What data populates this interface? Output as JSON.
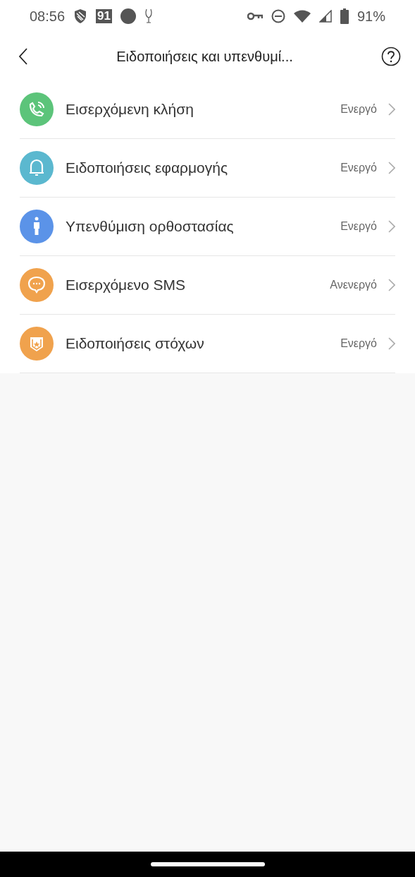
{
  "status_bar": {
    "time": "08:56",
    "badge": "91",
    "battery": "91%"
  },
  "header": {
    "title": "Ειδοποιήσεις και υπενθυμί..."
  },
  "items": [
    {
      "kind": "call",
      "color": "#5cc47a",
      "label": "Εισερχόμενη κλήση",
      "status": "Ενεργό"
    },
    {
      "kind": "bell",
      "color": "#5bb8cf",
      "label": "Ειδοποιήσεις εφαρμογής",
      "status": "Ενεργό"
    },
    {
      "kind": "person",
      "color": "#5b93e8",
      "label": "Υπενθύμιση ορθοστασίας",
      "status": "Ενεργό"
    },
    {
      "kind": "sms",
      "color": "#f0a24d",
      "label": "Εισερχόμενο SMS",
      "status": "Ανενεργό"
    },
    {
      "kind": "goal",
      "color": "#f0a24d",
      "label": "Ειδοποιήσεις στόχων",
      "status": "Ενεργό"
    }
  ]
}
